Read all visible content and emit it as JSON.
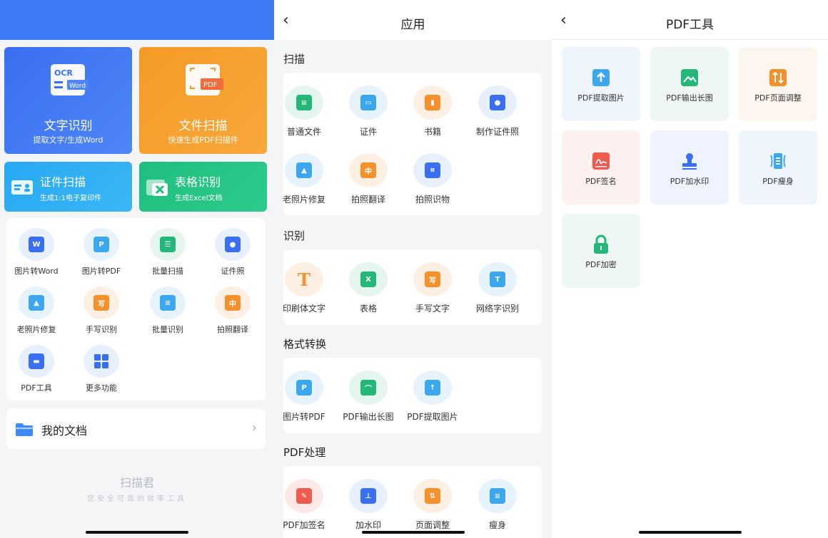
{
  "screen1": {
    "card_ocr": {
      "title": "文字识别",
      "subtitle": "提取文字/生成Word",
      "icon_text_top": "OCR",
      "icon_text_tag": "Word"
    },
    "card_scan": {
      "title": "文件扫描",
      "subtitle": "快速生成PDF扫描件",
      "icon_text_tag": "PDF"
    },
    "card_id": {
      "title": "证件扫描",
      "subtitle": "生成1:1电子复印件"
    },
    "card_table": {
      "title": "表格识别",
      "subtitle": "生成Excel文档"
    },
    "tools": [
      {
        "label": "图片转Word",
        "icon": "image-to-word-icon"
      },
      {
        "label": "图片转PDF",
        "icon": "image-to-pdf-icon"
      },
      {
        "label": "批量扫描",
        "icon": "batch-scan-icon"
      },
      {
        "label": "证件照",
        "icon": "id-photo-icon"
      },
      {
        "label": "老照片修复",
        "icon": "photo-repair-icon"
      },
      {
        "label": "手写识别",
        "icon": "handwriting-icon"
      },
      {
        "label": "批量识别",
        "icon": "batch-recognize-icon"
      },
      {
        "label": "拍照翻译",
        "icon": "photo-translate-icon"
      },
      {
        "label": "PDF工具",
        "icon": "toolbox-icon"
      },
      {
        "label": "更多功能",
        "icon": "more-grid-icon"
      }
    ],
    "my_docs": "我的文档",
    "brand": "扫描君",
    "brand_sub": "您安全可靠的效率工具"
  },
  "screen2": {
    "title": "应用",
    "sections": [
      {
        "title": "扫描",
        "items": [
          "普通文件",
          "证件",
          "书籍",
          "制作证件照",
          "老照片修复",
          "拍照翻译",
          "拍照识物"
        ]
      },
      {
        "title": "识别",
        "items": [
          "印刷体文字",
          "表格",
          "手写文字",
          "网络字识别"
        ]
      },
      {
        "title": "格式转换",
        "items": [
          "图片转PDF",
          "PDF输出长图",
          "PDF提取图片"
        ]
      },
      {
        "title": "PDF处理",
        "items": [
          "PDF加签名",
          "加水印",
          "页面调整",
          "瘦身"
        ]
      }
    ]
  },
  "screen3": {
    "title": "PDF工具",
    "tiles": [
      {
        "label": "PDF提取图片",
        "icon": "extract-image-icon"
      },
      {
        "label": "PDF输出长图",
        "icon": "long-image-icon"
      },
      {
        "label": "PDF页面调整",
        "icon": "page-adjust-icon"
      },
      {
        "label": "PDF签名",
        "icon": "signature-icon"
      },
      {
        "label": "PDF加水印",
        "icon": "watermark-stamp-icon"
      },
      {
        "label": "PDF瘦身",
        "icon": "compress-icon"
      },
      {
        "label": "PDF加密",
        "icon": "lock-icon"
      }
    ]
  },
  "colors": {
    "primary_blue": "#3d7cf6",
    "orange": "#f59a26",
    "cyan": "#27a9f4",
    "green": "#1ebe7f"
  }
}
